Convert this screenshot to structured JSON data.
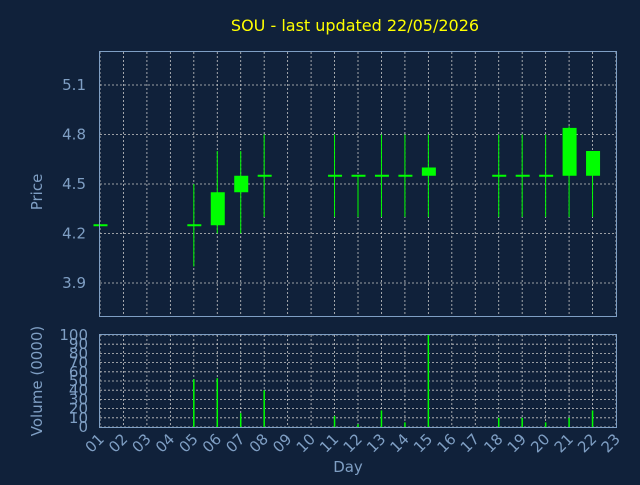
{
  "title": "SOU - last updated 22/05/2026",
  "colors": {
    "background": "#10213a",
    "axis": "#7f9fc4",
    "title": "#ffff00",
    "candle": "#00ff00",
    "grid": "#c8c8c8"
  },
  "chart_data": [
    {
      "type": "candlestick",
      "ylabel": "Price",
      "ylim": [
        3.7,
        5.3
      ],
      "yticks": [
        "3.9",
        "4.2",
        "4.5",
        "4.8",
        "5.1"
      ],
      "grid": true,
      "candles": [
        {
          "day": "01",
          "open": 4.25,
          "high": 4.25,
          "low": 4.25,
          "close": 4.25
        },
        {
          "day": "05",
          "open": 4.25,
          "high": 4.5,
          "low": 4.0,
          "close": 4.25
        },
        {
          "day": "06",
          "open": 4.25,
          "high": 4.7,
          "low": 4.2,
          "close": 4.45
        },
        {
          "day": "07",
          "open": 4.45,
          "high": 4.7,
          "low": 4.2,
          "close": 4.55
        },
        {
          "day": "08",
          "open": 4.55,
          "high": 4.8,
          "low": 4.3,
          "close": 4.55
        },
        {
          "day": "11",
          "open": 4.55,
          "high": 4.8,
          "low": 4.3,
          "close": 4.55
        },
        {
          "day": "12",
          "open": 4.55,
          "high": 4.55,
          "low": 4.3,
          "close": 4.55
        },
        {
          "day": "13",
          "open": 4.55,
          "high": 4.8,
          "low": 4.3,
          "close": 4.55
        },
        {
          "day": "14",
          "open": 4.55,
          "high": 4.8,
          "low": 4.3,
          "close": 4.55
        },
        {
          "day": "15",
          "open": 4.55,
          "high": 4.8,
          "low": 4.3,
          "close": 4.6
        },
        {
          "day": "18",
          "open": 4.55,
          "high": 4.8,
          "low": 4.3,
          "close": 4.55
        },
        {
          "day": "19",
          "open": 4.55,
          "high": 4.8,
          "low": 4.3,
          "close": 4.55
        },
        {
          "day": "20",
          "open": 4.55,
          "high": 4.8,
          "low": 4.3,
          "close": 4.55
        },
        {
          "day": "21",
          "open": 4.55,
          "high": 4.85,
          "low": 4.3,
          "close": 4.84
        },
        {
          "day": "22",
          "open": 4.55,
          "high": 4.7,
          "low": 4.3,
          "close": 4.7
        }
      ]
    },
    {
      "type": "bar",
      "ylabel": "Volume (0000)",
      "xlabel": "Day",
      "ylim": [
        0,
        100
      ],
      "yticks": [
        "0",
        "10",
        "20",
        "30",
        "40",
        "50",
        "60",
        "70",
        "80",
        "90",
        "100"
      ],
      "grid": true,
      "categories": [
        "01",
        "05",
        "06",
        "07",
        "08",
        "11",
        "12",
        "13",
        "14",
        "15",
        "18",
        "19",
        "20",
        "21",
        "22"
      ],
      "values": [
        0,
        52,
        53,
        15,
        40,
        12,
        3,
        18,
        5,
        100,
        10,
        10,
        5,
        10,
        18
      ],
      "xticks": [
        "01",
        "02",
        "03",
        "04",
        "05",
        "06",
        "07",
        "08",
        "09",
        "10",
        "11",
        "12",
        "13",
        "14",
        "15",
        "16",
        "17",
        "18",
        "19",
        "20",
        "21",
        "22",
        "23"
      ]
    }
  ]
}
